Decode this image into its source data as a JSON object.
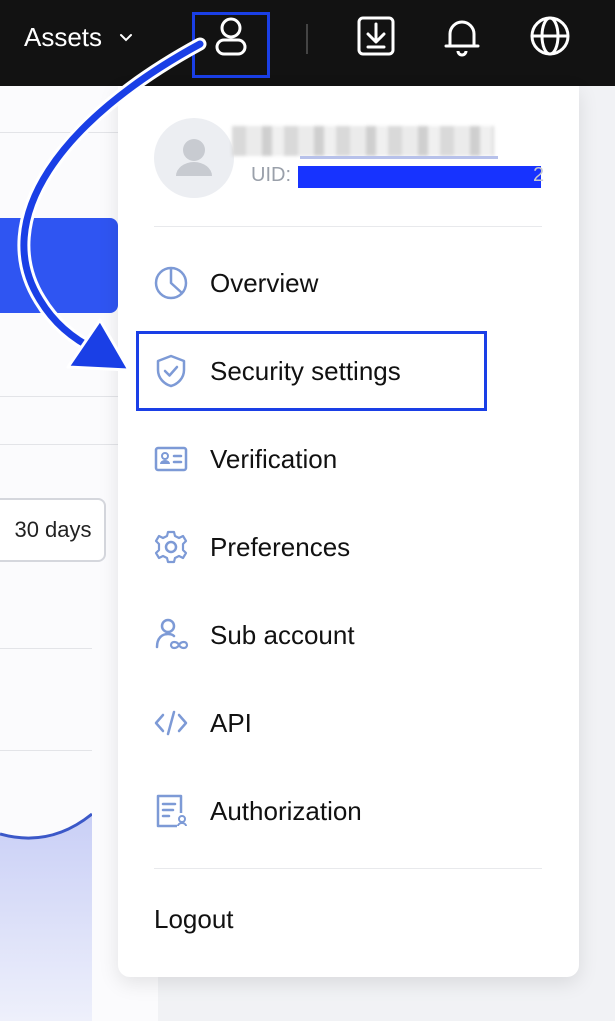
{
  "topbar": {
    "assets_label": "Assets",
    "icons": [
      "chevron-down-icon",
      "user-icon",
      "download-icon",
      "bell-icon",
      "globe-icon"
    ]
  },
  "background": {
    "range_button": "30 days"
  },
  "dropdown": {
    "uid_prefix": "UID:",
    "uid_tail": "2",
    "items": [
      {
        "label": "Overview",
        "icon": "pie-chart-icon"
      },
      {
        "label": "Security settings",
        "icon": "shield-check-icon"
      },
      {
        "label": "Verification",
        "icon": "id-card-icon"
      },
      {
        "label": "Preferences",
        "icon": "gear-icon"
      },
      {
        "label": "Sub account",
        "icon": "sub-account-icon"
      },
      {
        "label": "API",
        "icon": "code-icon"
      },
      {
        "label": "Authorization",
        "icon": "authorization-icon"
      }
    ],
    "logout_label": "Logout"
  },
  "colors": {
    "accent": "#1a3fe6",
    "icon": "#7d9ad6",
    "topbar": "#121212"
  }
}
